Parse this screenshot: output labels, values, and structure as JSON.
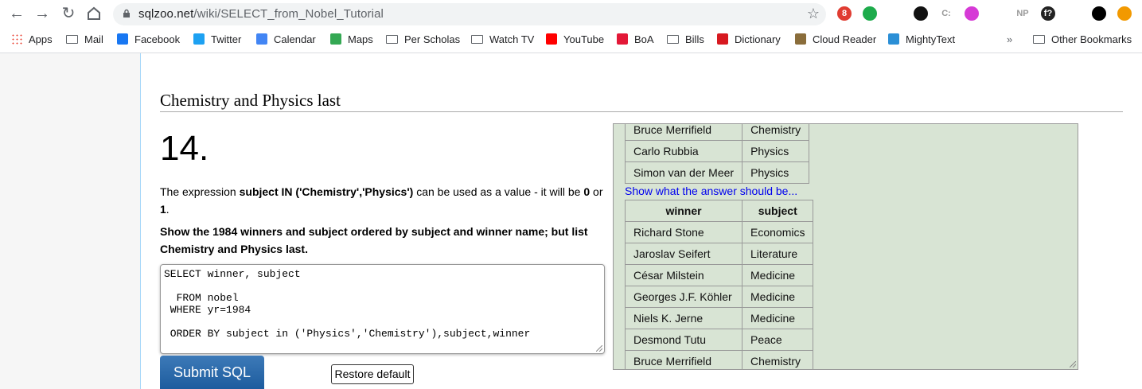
{
  "browser": {
    "url_host": "sqlzoo.net",
    "url_path": "/wiki/SELECT_from_Nobel_Tutorial",
    "extensions": [
      {
        "name": "abp-icon",
        "label": "8",
        "color": "#e03c31"
      },
      {
        "name": "evernote-icon",
        "label": "",
        "color": "#1dab4b"
      },
      {
        "name": "camera-icon",
        "label": "",
        "color": "#888888"
      },
      {
        "name": "dark-mode-icon",
        "label": "",
        "color": "#111111"
      },
      {
        "name": "c-extension-icon",
        "label": "C:",
        "color": "#999999"
      },
      {
        "name": "purple-extension-icon",
        "label": "",
        "color": "#d63ad6"
      },
      {
        "name": "grid-extension-icon",
        "label": "",
        "color": "#dddddd"
      },
      {
        "name": "np-extension-icon",
        "label": "NP",
        "color": "#999999"
      },
      {
        "name": "f-extension-icon",
        "label": "f?",
        "color": "#222222"
      },
      {
        "name": "puzzle-icon",
        "label": "",
        "color": "#5f6368"
      },
      {
        "name": "profile-icon",
        "label": "",
        "color": "#000000"
      },
      {
        "name": "update-icon",
        "label": "",
        "color": "#f29900"
      }
    ]
  },
  "bookmarks": {
    "items": [
      {
        "label": "Apps",
        "icon": "apps-grid-icon",
        "color": "#ea4335"
      },
      {
        "label": "Mail",
        "icon": "folder-icon",
        "color": ""
      },
      {
        "label": "Facebook",
        "icon": "facebook-icon",
        "color": "#1877f2"
      },
      {
        "label": "Twitter",
        "icon": "twitter-icon",
        "color": "#1da1f2"
      },
      {
        "label": "Calendar",
        "icon": "calendar-icon",
        "color": "#4285f4"
      },
      {
        "label": "Maps",
        "icon": "maps-pin-icon",
        "color": "#34a853"
      },
      {
        "label": "Per Scholas",
        "icon": "folder-icon",
        "color": ""
      },
      {
        "label": "Watch TV",
        "icon": "folder-icon",
        "color": ""
      },
      {
        "label": "YouTube",
        "icon": "youtube-icon",
        "color": "#ff0000"
      },
      {
        "label": "BoA",
        "icon": "boa-icon",
        "color": "#e31837"
      },
      {
        "label": "Bills",
        "icon": "folder-icon",
        "color": ""
      },
      {
        "label": "Dictionary",
        "icon": "merriam-webster-icon",
        "color": "#d71920"
      },
      {
        "label": "Cloud Reader",
        "icon": "kindle-icon",
        "color": "#8a6d3b"
      },
      {
        "label": "MightyText",
        "icon": "mightytext-icon",
        "color": "#2b8fd6"
      }
    ],
    "overflow": "»",
    "other": "Other Bookmarks"
  },
  "page": {
    "section_title": "Chemistry and Physics last",
    "question_number": "14.",
    "para1_a": "The expression ",
    "para1_b": "subject IN ('Chemistry','Physics')",
    "para1_c": " can be used as a value - it will be ",
    "para1_d": "0",
    "para1_e": " or ",
    "para1_f": "1",
    "para1_g": ".",
    "task": "Show the 1984 winners and subject ordered by subject and winner name; but list Chemistry and Physics last.",
    "sql": "SELECT winner, subject\n\n  FROM nobel\n WHERE yr=1984\n\n ORDER BY subject in ('Physics','Chemistry'),subject,winner",
    "submit_label": "Submit SQL",
    "restore_label": "Restore default"
  },
  "results": {
    "top_rows": [
      [
        "Bruce Merrifield",
        "Chemistry"
      ],
      [
        "Carlo Rubbia",
        "Physics"
      ],
      [
        "Simon van der Meer",
        "Physics"
      ]
    ],
    "show_answer_link": "Show what the answer should be...",
    "headers": [
      "winner",
      "subject"
    ],
    "answer_rows": [
      [
        "Richard Stone",
        "Economics"
      ],
      [
        "Jaroslav Seifert",
        "Literature"
      ],
      [
        "César Milstein",
        "Medicine"
      ],
      [
        "Georges J.F. Köhler",
        "Medicine"
      ],
      [
        "Niels K. Jerne",
        "Medicine"
      ],
      [
        "Desmond Tutu",
        "Peace"
      ],
      [
        "Bruce Merrifield",
        "Chemistry"
      ]
    ]
  }
}
